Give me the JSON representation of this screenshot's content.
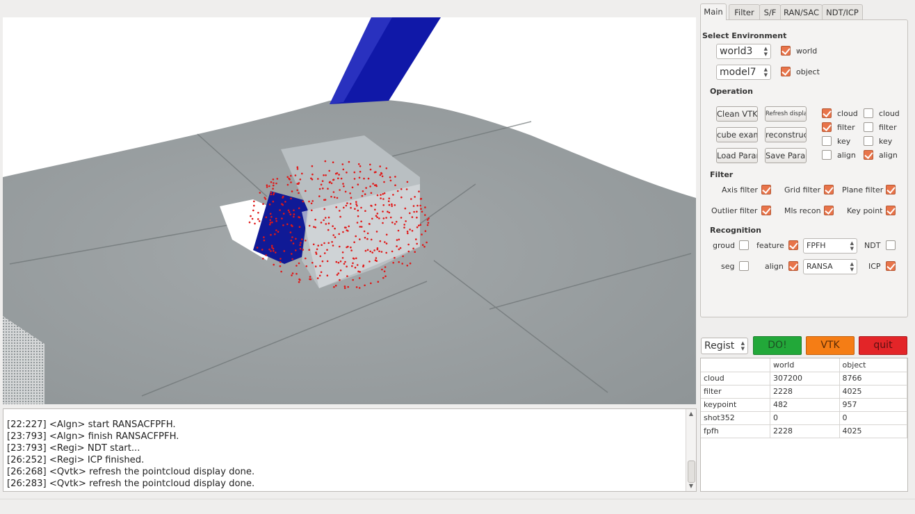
{
  "tabs": [
    "Main",
    "Filter",
    "S/F",
    "RAN/SAC",
    "NDT/ICP"
  ],
  "main": {
    "select_env_title": "Select Environment",
    "world_spin": "world3",
    "world_check_label": "world",
    "world_checked": true,
    "object_spin": "model7",
    "object_check_label": "object",
    "object_checked": true,
    "operation_title": "Operation",
    "buttons": {
      "clean_vtk": "Clean VTK",
      "refresh_display": "Refresh display",
      "cube_exam": "cube exam",
      "reconstruct": "reconstruct",
      "load_param": "Load Param",
      "save_param": "Save Param"
    },
    "display_checks": {
      "left": [
        {
          "label": "cloud",
          "checked": true
        },
        {
          "label": "filter",
          "checked": true
        },
        {
          "label": "key",
          "checked": false
        },
        {
          "label": "align",
          "checked": false
        }
      ],
      "right": [
        {
          "label": "cloud",
          "checked": false
        },
        {
          "label": "filter",
          "checked": false
        },
        {
          "label": "key",
          "checked": false
        },
        {
          "label": "align",
          "checked": true
        }
      ]
    },
    "filter_title": "Filter",
    "filters": [
      {
        "label": "Axis filter",
        "checked": true
      },
      {
        "label": "Grid filter",
        "checked": true
      },
      {
        "label": "Plane filter",
        "checked": true
      },
      {
        "label": "Outlier filter",
        "checked": true
      },
      {
        "label": "Mls recon",
        "checked": true
      },
      {
        "label": "Key point",
        "checked": true
      }
    ],
    "recognition_title": "Recognition",
    "recognition": {
      "groud_label": "groud",
      "groud_checked": false,
      "feature_label": "feature",
      "feature_checked": true,
      "feature_select": "FPFH",
      "ndt_label": "NDT",
      "ndt_checked": false,
      "seg_label": "seg",
      "seg_checked": false,
      "align_label": "align",
      "align_checked": true,
      "align_select": "RANSA",
      "icp_label": "ICP",
      "icp_checked": true
    }
  },
  "actions": {
    "mode_select": "Regist",
    "do_label": "DO!",
    "vtk_label": "VTK",
    "quit_label": "quit",
    "do_color": "#22a839",
    "vtk_color": "#f57d15",
    "quit_color": "#e32528"
  },
  "stats_table": {
    "headers": [
      "",
      "world",
      "object"
    ],
    "rows": [
      [
        "cloud",
        "307200",
        "8766"
      ],
      [
        "filter",
        "2228",
        "4025"
      ],
      [
        "keypoint",
        "482",
        "957"
      ],
      [
        "shot352",
        "0",
        "0"
      ],
      [
        "fpfh",
        "2228",
        "4025"
      ]
    ]
  },
  "log_lines": [
    "[22:227] <Algn>  start RANSACFPFH.",
    "[23:793] <Algn>  finish RANSACFPFH.",
    "[23:793] <Regi>  NDT start...",
    "[26:252] <Regi>  ICP finished.",
    "[26:268] <Qvtk>  refresh the pointcloud display done.",
    "[26:283] <Qvtk>  refresh the pointcloud display done."
  ],
  "viewport": {
    "cloud_colors": {
      "scene": "#9ea4a6",
      "aligned_model": "#e01818",
      "object": "#1a1f9c"
    }
  }
}
